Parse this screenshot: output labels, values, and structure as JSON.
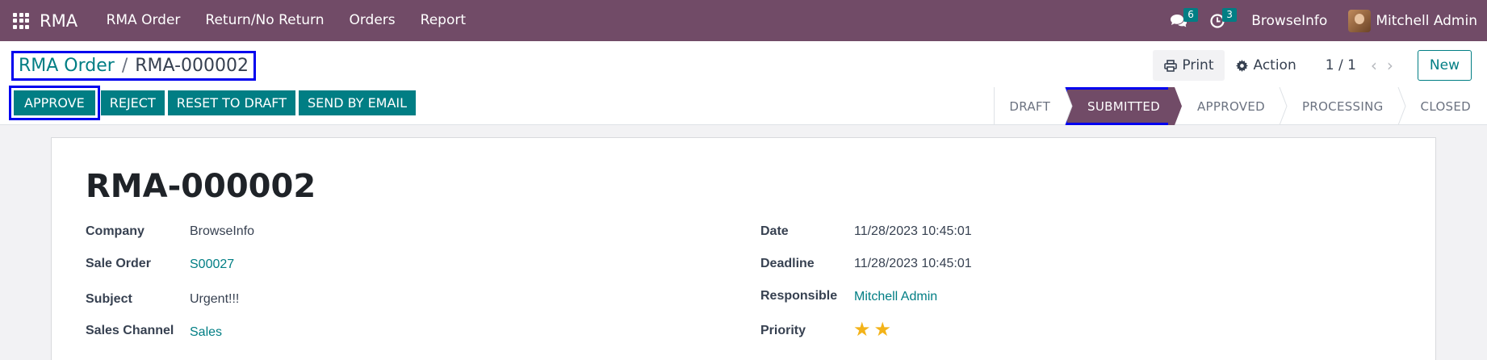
{
  "navbar": {
    "brand": "RMA",
    "menu": [
      "RMA Order",
      "Return/No Return",
      "Orders",
      "Report"
    ],
    "messages_count": "6",
    "activities_count": "3",
    "company": "BrowseInfo",
    "user": "Mitchell Admin",
    "accent_color": "#714b67"
  },
  "breadcrumb": {
    "parent": "RMA Order",
    "separator": "/",
    "current": "RMA-000002"
  },
  "control": {
    "print_label": "Print",
    "action_label": "Action",
    "pager": "1 / 1",
    "new_label": "New"
  },
  "actions": {
    "approve": "APPROVE",
    "reject": "REJECT",
    "reset": "RESET TO DRAFT",
    "send_email": "SEND BY EMAIL"
  },
  "statusbar": {
    "stages": [
      "DRAFT",
      "SUBMITTED",
      "APPROVED",
      "PROCESSING",
      "CLOSED"
    ],
    "current": "SUBMITTED"
  },
  "record": {
    "title": "RMA-000002",
    "left_fields": [
      {
        "label": "Company",
        "value": "BrowseInfo"
      },
      {
        "label": "Sale Order",
        "value": "S00027"
      },
      {
        "label": "Subject",
        "value": "Urgent!!!"
      },
      {
        "label": "Sales Channel",
        "value": "Sales"
      }
    ],
    "right_fields": [
      {
        "label": "Date",
        "value": "11/28/2023 10:45:01"
      },
      {
        "label": "Deadline",
        "value": "11/28/2023 10:45:01"
      },
      {
        "label": "Responsible",
        "value": "Mitchell Admin"
      },
      {
        "label": "Priority",
        "value": 2
      }
    ]
  },
  "colors": {
    "primary": "#017e84",
    "brand": "#714b67",
    "star": "#f3b319"
  }
}
